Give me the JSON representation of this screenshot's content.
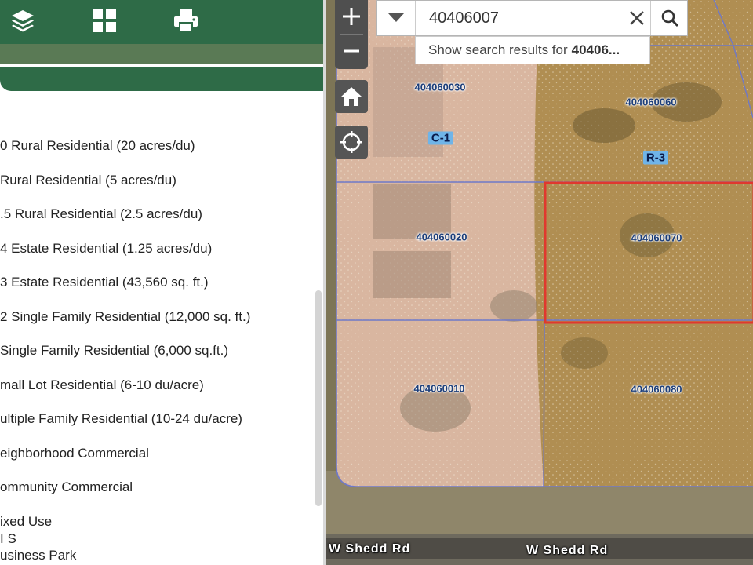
{
  "toolbar": {
    "icons": [
      "layers-icon",
      "grid-apps-icon",
      "print-icon"
    ]
  },
  "legend": {
    "items": [
      "0 Rural Residential (20 acres/du)",
      " Rural Residential (5 acres/du)",
      ".5 Rural Residential (2.5 acres/du)",
      "4 Estate Residential (1.25 acres/du)",
      "3 Estate Residential (43,560 sq. ft.)",
      "2 Single Family Residential (12,000 sq. ft.)",
      " Single Family Residential (6,000 sq.ft.)",
      "mall Lot Residential (6-10 du/acre)",
      "ultiple Family Residential (10-24 du/acre)",
      "eighborhood Commercial",
      "ommunity Commercial",
      "ixed Use",
      "I S",
      "usiness Park"
    ]
  },
  "search": {
    "value": "40406007",
    "suggestion_prefix": "Show search results for",
    "suggestion_term": "40406..."
  },
  "map": {
    "parcels": [
      "404060030",
      "404060060",
      "404060020",
      "404060070",
      "404060010",
      "404060080"
    ],
    "zones": [
      "C-1",
      "R-3"
    ],
    "roads": [
      "W Shedd Rd",
      "W Shedd Rd"
    ],
    "colors": {
      "toolbar": "#2e6b47",
      "selected_parcel": "#e0382e",
      "parcel_line": "#6e78c8",
      "zone_c1": "#e8b0a8",
      "zone_r3": "#c49a50"
    }
  }
}
